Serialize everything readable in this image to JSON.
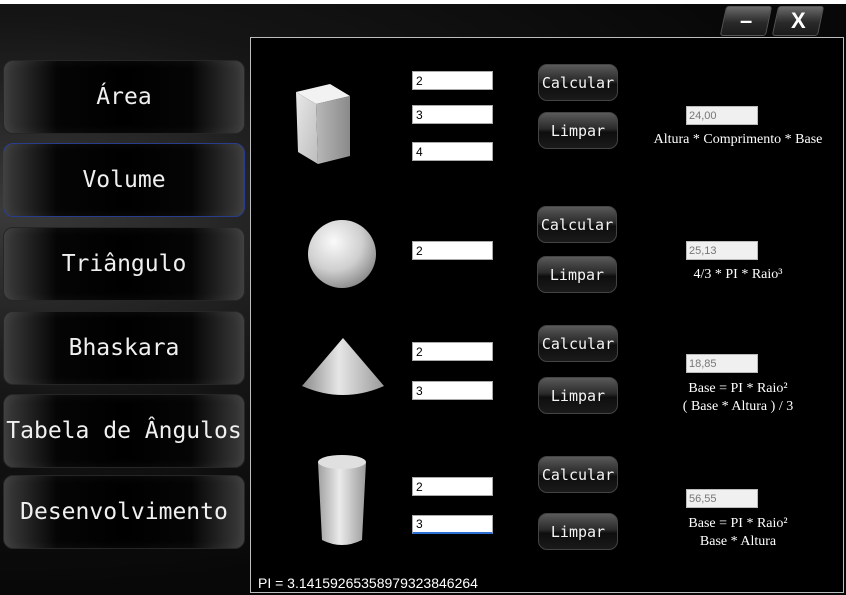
{
  "window": {
    "minimize_label": "–",
    "close_label": "X"
  },
  "menu": [
    {
      "label": "Área"
    },
    {
      "label": "Volume",
      "active": true
    },
    {
      "label": "Triângulo"
    },
    {
      "label": "Bhaskara"
    },
    {
      "label": "Tabela de Ângulos"
    },
    {
      "label": "Desenvolvimento"
    }
  ],
  "shapes": {
    "cube": {
      "inputs": [
        "2",
        "3",
        "4"
      ],
      "calc_label": "Calcular",
      "clear_label": "Limpar",
      "result": "24,00",
      "formula": [
        "Altura * Comprimento * Base"
      ]
    },
    "sphere": {
      "inputs": [
        "2"
      ],
      "calc_label": "Calcular",
      "clear_label": "Limpar",
      "result": "25,13",
      "formula": [
        "4/3 * PI * Raio³"
      ]
    },
    "cone": {
      "inputs": [
        "2",
        "3"
      ],
      "calc_label": "Calcular",
      "clear_label": "Limpar",
      "result": "18,85",
      "formula": [
        "Base = PI * Raio²",
        "( Base * Altura ) / 3"
      ]
    },
    "cylinder": {
      "inputs": [
        "2",
        "3"
      ],
      "calc_label": "Calcular",
      "clear_label": "Limpar",
      "result": "56,55",
      "formula": [
        "Base = PI * Raio²",
        "Base * Altura"
      ]
    }
  },
  "pi_text": "PI = 3.14159265358979323846264"
}
